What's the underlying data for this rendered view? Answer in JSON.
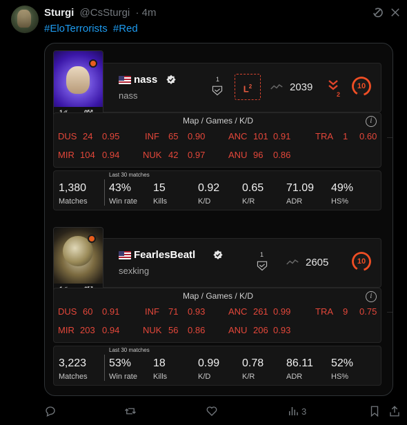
{
  "tweet": {
    "author_name": "Sturgi",
    "handle": "@CsSturgi",
    "time": "· 4m",
    "hashtags": [
      "#EloTerrorists",
      "#Red"
    ],
    "views": "3"
  },
  "icons": {
    "top": [
      "grok-icon",
      "more-icon"
    ],
    "actions": [
      "reply-icon",
      "retweet-icon",
      "like-icon",
      "views-icon",
      "bookmark-icon",
      "share-icon"
    ]
  },
  "colors": {
    "link": "#1d9bf0",
    "stat_red": "#e4473a",
    "faceit_orange": "#f04e24"
  },
  "players": [
    {
      "name": "nass",
      "username": "nass",
      "pic_foot_a": "1✐",
      "pic_foot_b": "0⤱",
      "handshake_count": "1",
      "l_badge": "L",
      "l_badge_sup": "2",
      "elo": "2039",
      "rank_num": "2",
      "level": "10",
      "map_title": "Map / Games / K/D",
      "maps_row1": [
        [
          "DUS",
          "24",
          "0.95"
        ],
        [
          "INF",
          "65",
          "0.90"
        ],
        [
          "ANC",
          "101",
          "0.91"
        ],
        [
          "TRA",
          "1",
          "0.60"
        ]
      ],
      "maps_row2": [
        [
          "MIR",
          "104",
          "0.94"
        ],
        [
          "NUK",
          "42",
          "0.97"
        ],
        [
          "ANU",
          "96",
          "0.86"
        ]
      ],
      "last30": "Last 30 matches",
      "stats": [
        {
          "value": "1,380",
          "label": "Matches"
        },
        {
          "value": "43%",
          "label": "Win rate"
        },
        {
          "value": "15",
          "label": "Kills"
        },
        {
          "value": "0.92",
          "label": "K/D"
        },
        {
          "value": "0.65",
          "label": "K/R"
        },
        {
          "value": "71.09",
          "label": "ADR"
        },
        {
          "value": "49%",
          "label": "HS%"
        }
      ]
    },
    {
      "name": "FearlesBeatl",
      "username": "sexking",
      "pic_foot_a": "1✐",
      "pic_foot_b": "0⤱",
      "handshake_count": "1",
      "elo": "2605",
      "level": "10",
      "map_title": "Map / Games / K/D",
      "maps_row1": [
        [
          "DUS",
          "60",
          "0.91"
        ],
        [
          "INF",
          "71",
          "0.93"
        ],
        [
          "ANC",
          "261",
          "0.99"
        ],
        [
          "TRA",
          "9",
          "0.75"
        ]
      ],
      "maps_row2": [
        [
          "MIR",
          "203",
          "0.94"
        ],
        [
          "NUK",
          "56",
          "0.86"
        ],
        [
          "ANU",
          "206",
          "0.93"
        ]
      ],
      "last30": "Last 30 matches",
      "stats": [
        {
          "value": "3,223",
          "label": "Matches"
        },
        {
          "value": "53%",
          "label": "Win rate"
        },
        {
          "value": "18",
          "label": "Kills"
        },
        {
          "value": "0.99",
          "label": "K/D"
        },
        {
          "value": "0.78",
          "label": "K/R"
        },
        {
          "value": "86.11",
          "label": "ADR"
        },
        {
          "value": "52%",
          "label": "HS%"
        }
      ]
    }
  ]
}
